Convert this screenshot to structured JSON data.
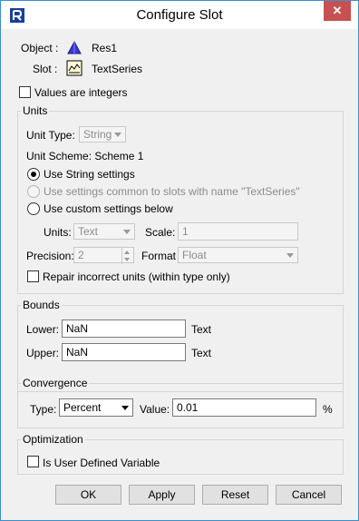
{
  "window": {
    "title": "Configure Slot",
    "close_label": "✕"
  },
  "object": {
    "label": "Object :",
    "value": "Res1",
    "icon": "reservoir-triangle-icon",
    "icon_color": "#3a3ad8"
  },
  "slot": {
    "label": "Slot :",
    "value": "TextSeries",
    "icon": "series-slot-icon"
  },
  "values_integers_label": "Values are integers",
  "units": {
    "group_title": "Units",
    "unit_type_label": "Unit Type:",
    "unit_type_value": "String",
    "unit_scheme_label": "Unit Scheme: Scheme 1",
    "radio_string": "Use String settings",
    "radio_common": "Use settings common to slots with name \"TextSeries\"",
    "radio_custom": "Use custom settings below",
    "units_label": "Units:",
    "units_value": "Text",
    "scale_label": "Scale:",
    "scale_value": "1",
    "precision_label": "Precision:",
    "precision_value": "2",
    "format_label": "Format",
    "format_value": "Float",
    "repair_label": "Repair incorrect units (within type only)"
  },
  "bounds": {
    "group_title": "Bounds",
    "lower_label": "Lower:",
    "lower_value": "NaN",
    "lower_unit": "Text",
    "upper_label": "Upper:",
    "upper_value": "NaN",
    "upper_unit": "Text"
  },
  "convergence": {
    "group_title": "Convergence",
    "type_label": "Type:",
    "type_value": "Percent",
    "value_label": "Value:",
    "value": "0.01",
    "unit": "%"
  },
  "optimization": {
    "group_title": "Optimization",
    "user_defined_label": "Is User Defined Variable"
  },
  "buttons": {
    "ok": "OK",
    "apply": "Apply",
    "reset": "Reset",
    "cancel": "Cancel"
  }
}
